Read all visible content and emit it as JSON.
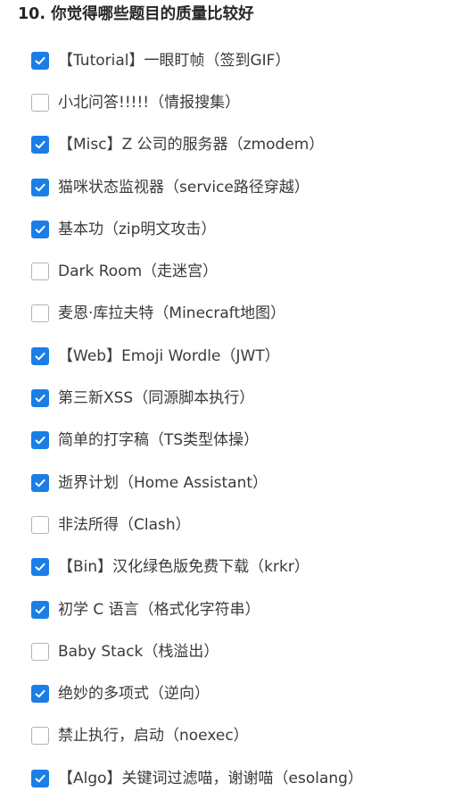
{
  "question": {
    "title": "10. 你觉得哪些题目的质量比较好",
    "options": [
      {
        "label": "【Tutorial】一眼盯帧（签到GIF）",
        "checked": true
      },
      {
        "label": "小北问答!!!!!（情报搜集）",
        "checked": false
      },
      {
        "label": "【Misc】Z 公司的服务器（zmodem）",
        "checked": true
      },
      {
        "label": "猫咪状态监视器（service路径穿越）",
        "checked": true
      },
      {
        "label": "基本功（zip明文攻击）",
        "checked": true
      },
      {
        "label": "Dark Room（走迷宫）",
        "checked": false
      },
      {
        "label": "麦恩·库拉夫特（Minecraft地图）",
        "checked": false
      },
      {
        "label": "【Web】Emoji Wordle（JWT）",
        "checked": true
      },
      {
        "label": "第三新XSS（同源脚本执行）",
        "checked": true
      },
      {
        "label": "简单的打字稿（TS类型体操）",
        "checked": true
      },
      {
        "label": "逝界计划（Home Assistant）",
        "checked": true
      },
      {
        "label": "非法所得（Clash）",
        "checked": false
      },
      {
        "label": "【Bin】汉化绿色版免费下载（krkr）",
        "checked": true
      },
      {
        "label": "初学 C 语言（格式化字符串）",
        "checked": true
      },
      {
        "label": "Baby Stack（栈溢出）",
        "checked": false
      },
      {
        "label": "绝妙的多项式（逆向）",
        "checked": true
      },
      {
        "label": "禁止执行，启动（noexec）",
        "checked": false
      },
      {
        "label": "【Algo】关键词过滤喵，谢谢喵（esolang）",
        "checked": true
      }
    ]
  },
  "colors": {
    "accent": "#1a7ee6",
    "unchecked_border": "#b3b3b3"
  },
  "icons": {
    "checked": "checkmark-icon"
  }
}
